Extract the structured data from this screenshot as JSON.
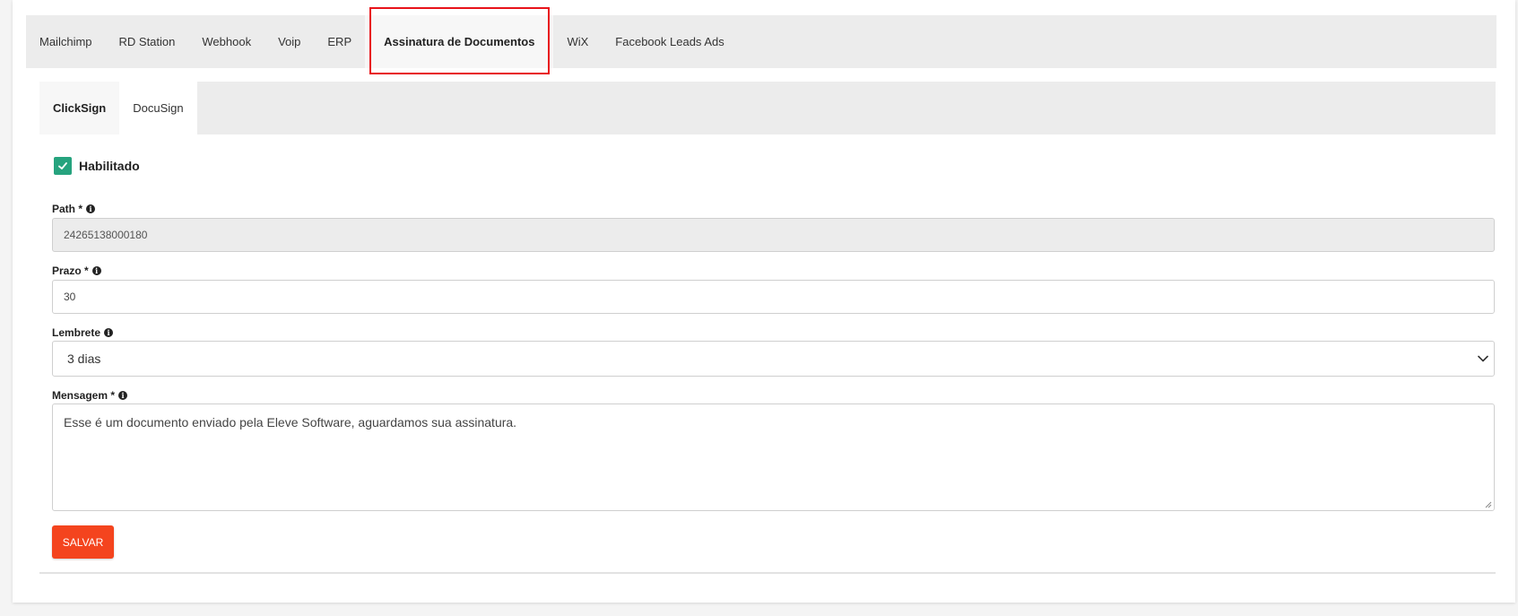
{
  "top_tabs": [
    {
      "label": "Mailchimp"
    },
    {
      "label": "RD Station"
    },
    {
      "label": "Webhook"
    },
    {
      "label": "Voip"
    },
    {
      "label": "ERP"
    },
    {
      "label": "Assinatura de Documentos",
      "active": true
    },
    {
      "label": "WiX"
    },
    {
      "label": "Facebook Leads Ads"
    }
  ],
  "sub_tabs": [
    {
      "label": "ClickSign",
      "active": true
    },
    {
      "label": "DocuSign"
    }
  ],
  "enabled": {
    "label": "Habilitado",
    "checked": true
  },
  "fields": {
    "path": {
      "label": "Path *",
      "value": "24265138000180",
      "disabled": true
    },
    "prazo": {
      "label": "Prazo *",
      "value": "30"
    },
    "lembrete": {
      "label": "Lembrete",
      "selected": "3 dias"
    },
    "mensagem": {
      "label": "Mensagem *",
      "value": "Esse é um documento enviado pela Eleve Software, aguardamos sua assinatura."
    }
  },
  "save_button": {
    "label": "SALVAR"
  },
  "colors": {
    "accent_button": "#f4441e",
    "checkbox": "#26a37e",
    "highlight_border": "#e8131a",
    "tab_bar": "#ececec"
  },
  "icons": {
    "info": "info-circle-icon",
    "check": "check-icon",
    "select_arrow": "chevron-down-icon"
  }
}
